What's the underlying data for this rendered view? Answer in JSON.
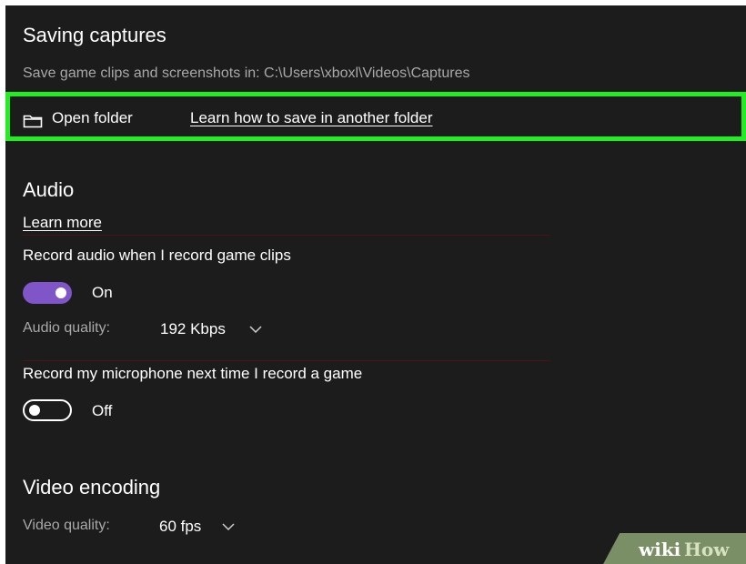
{
  "saving_captures": {
    "title": "Saving captures",
    "location_text": "Save game clips and screenshots in: C:\\Users\\xboxl\\Videos\\Captures",
    "open_folder_label": "Open folder",
    "learn_folder_link": "Learn how to save in another folder",
    "highlight_color": "#21ee21"
  },
  "audio": {
    "title": "Audio",
    "learn_more_link": "Learn more",
    "record_audio_label": "Record audio when I record game clips",
    "record_audio_state": "On",
    "toggle_on_color": "#7f55c7",
    "quality_label": "Audio quality:",
    "quality_value": "192 Kbps",
    "mic_label": "Record my microphone next time I record a game",
    "mic_state": "Off"
  },
  "video": {
    "title": "Video encoding",
    "quality_label": "Video quality:",
    "quality_value": "60 fps"
  },
  "watermark": {
    "text_wiki": "wiki",
    "text_how": "How"
  }
}
